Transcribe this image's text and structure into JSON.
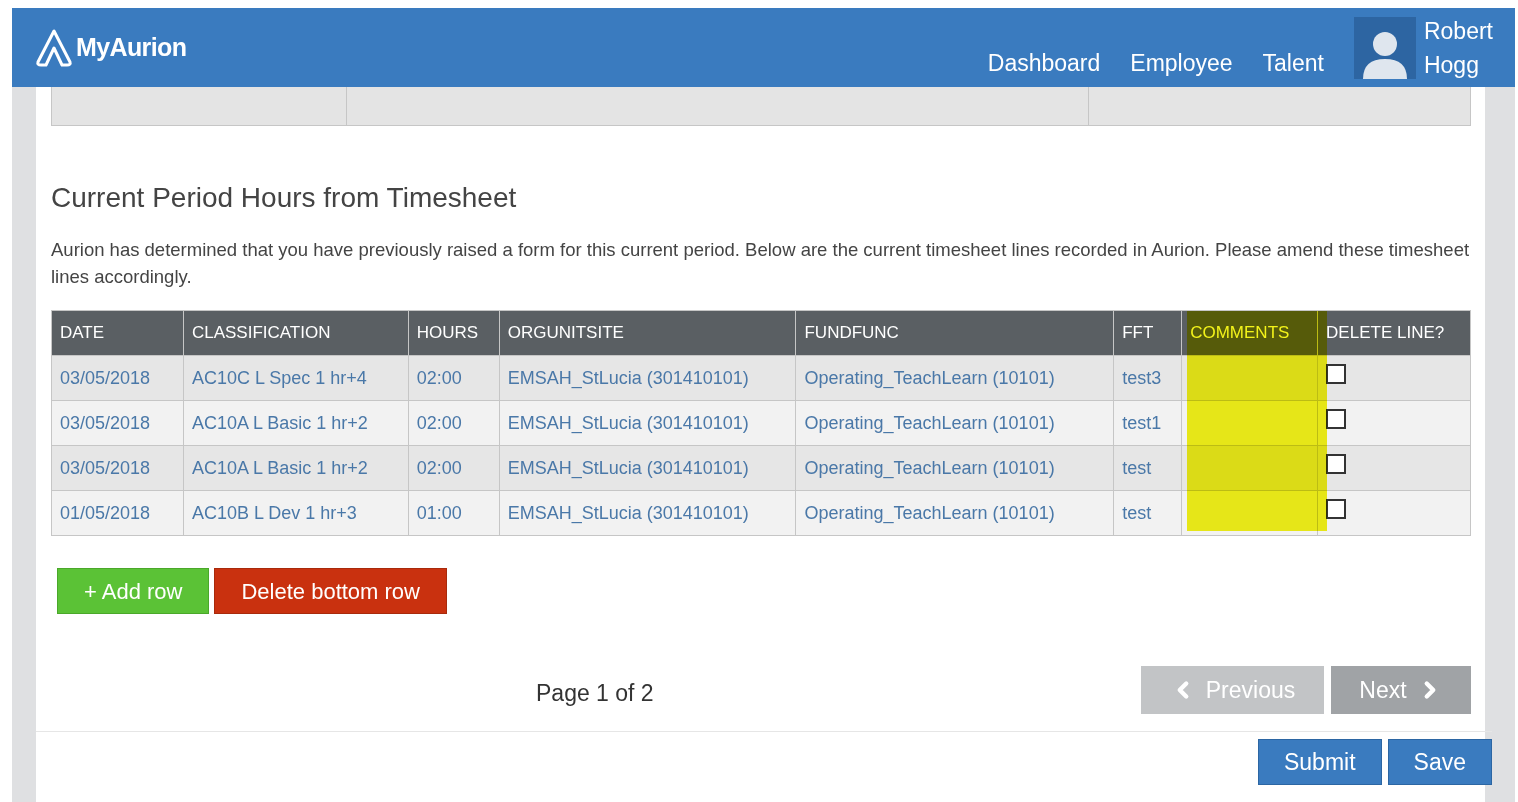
{
  "header": {
    "logo": "MyAurion",
    "nav": [
      {
        "label": "Dashboard"
      },
      {
        "label": "Employee"
      },
      {
        "label": "Talent"
      }
    ],
    "user": {
      "first": "Robert",
      "last": "Hogg"
    }
  },
  "section": {
    "title": "Current Period Hours from Timesheet",
    "description": "Aurion has determined that you have previously raised a form for this current period.  Below are the current timesheet lines recorded in Aurion.  Please amend these timesheet lines accordingly."
  },
  "table": {
    "columns": [
      {
        "label": "DATE",
        "highlighted": false
      },
      {
        "label": "CLASSIFICATION",
        "highlighted": false
      },
      {
        "label": "HOURS",
        "highlighted": false
      },
      {
        "label": "ORGUNITSITE",
        "highlighted": false
      },
      {
        "label": "FUNDFUNC",
        "highlighted": false
      },
      {
        "label": "FFT",
        "highlighted": false
      },
      {
        "label": "COMMENTS",
        "highlighted": true
      },
      {
        "label": "DELETE LINE?",
        "highlighted": false
      }
    ],
    "rows": [
      {
        "cells": [
          "03/05/2018",
          "AC10C L Spec 1 hr+4",
          "02:00",
          "EMSAH_StLucia (301410101)",
          "Operating_TeachLearn (10101)",
          "test3"
        ],
        "delete": false
      },
      {
        "cells": [
          "03/05/2018",
          "AC10A L Basic 1 hr+2",
          "02:00",
          "EMSAH_StLucia (301410101)",
          "Operating_TeachLearn (10101)",
          "test1"
        ],
        "delete": false
      },
      {
        "cells": [
          "03/05/2018",
          "AC10A L Basic 1 hr+2",
          "02:00",
          "EMSAH_StLucia (301410101)",
          "Operating_TeachLearn (10101)",
          "test"
        ],
        "delete": false
      },
      {
        "cells": [
          "01/05/2018",
          "AC10B L Dev 1 hr+3",
          "01:00",
          "EMSAH_StLucia (301410101)",
          "Operating_TeachLearn (10101)",
          "test"
        ],
        "delete": false
      }
    ]
  },
  "row_buttons": [
    {
      "kind": "add",
      "label": "+ Add row"
    },
    {
      "kind": "delete",
      "label": "Delete bottom row"
    }
  ],
  "pager": {
    "text": "Page 1 of 2",
    "previous": {
      "label": "Previous",
      "disabled": true
    },
    "next": {
      "label": "Next",
      "disabled": false
    }
  },
  "actions": [
    {
      "label": "Submit"
    },
    {
      "label": "Save"
    }
  ]
}
